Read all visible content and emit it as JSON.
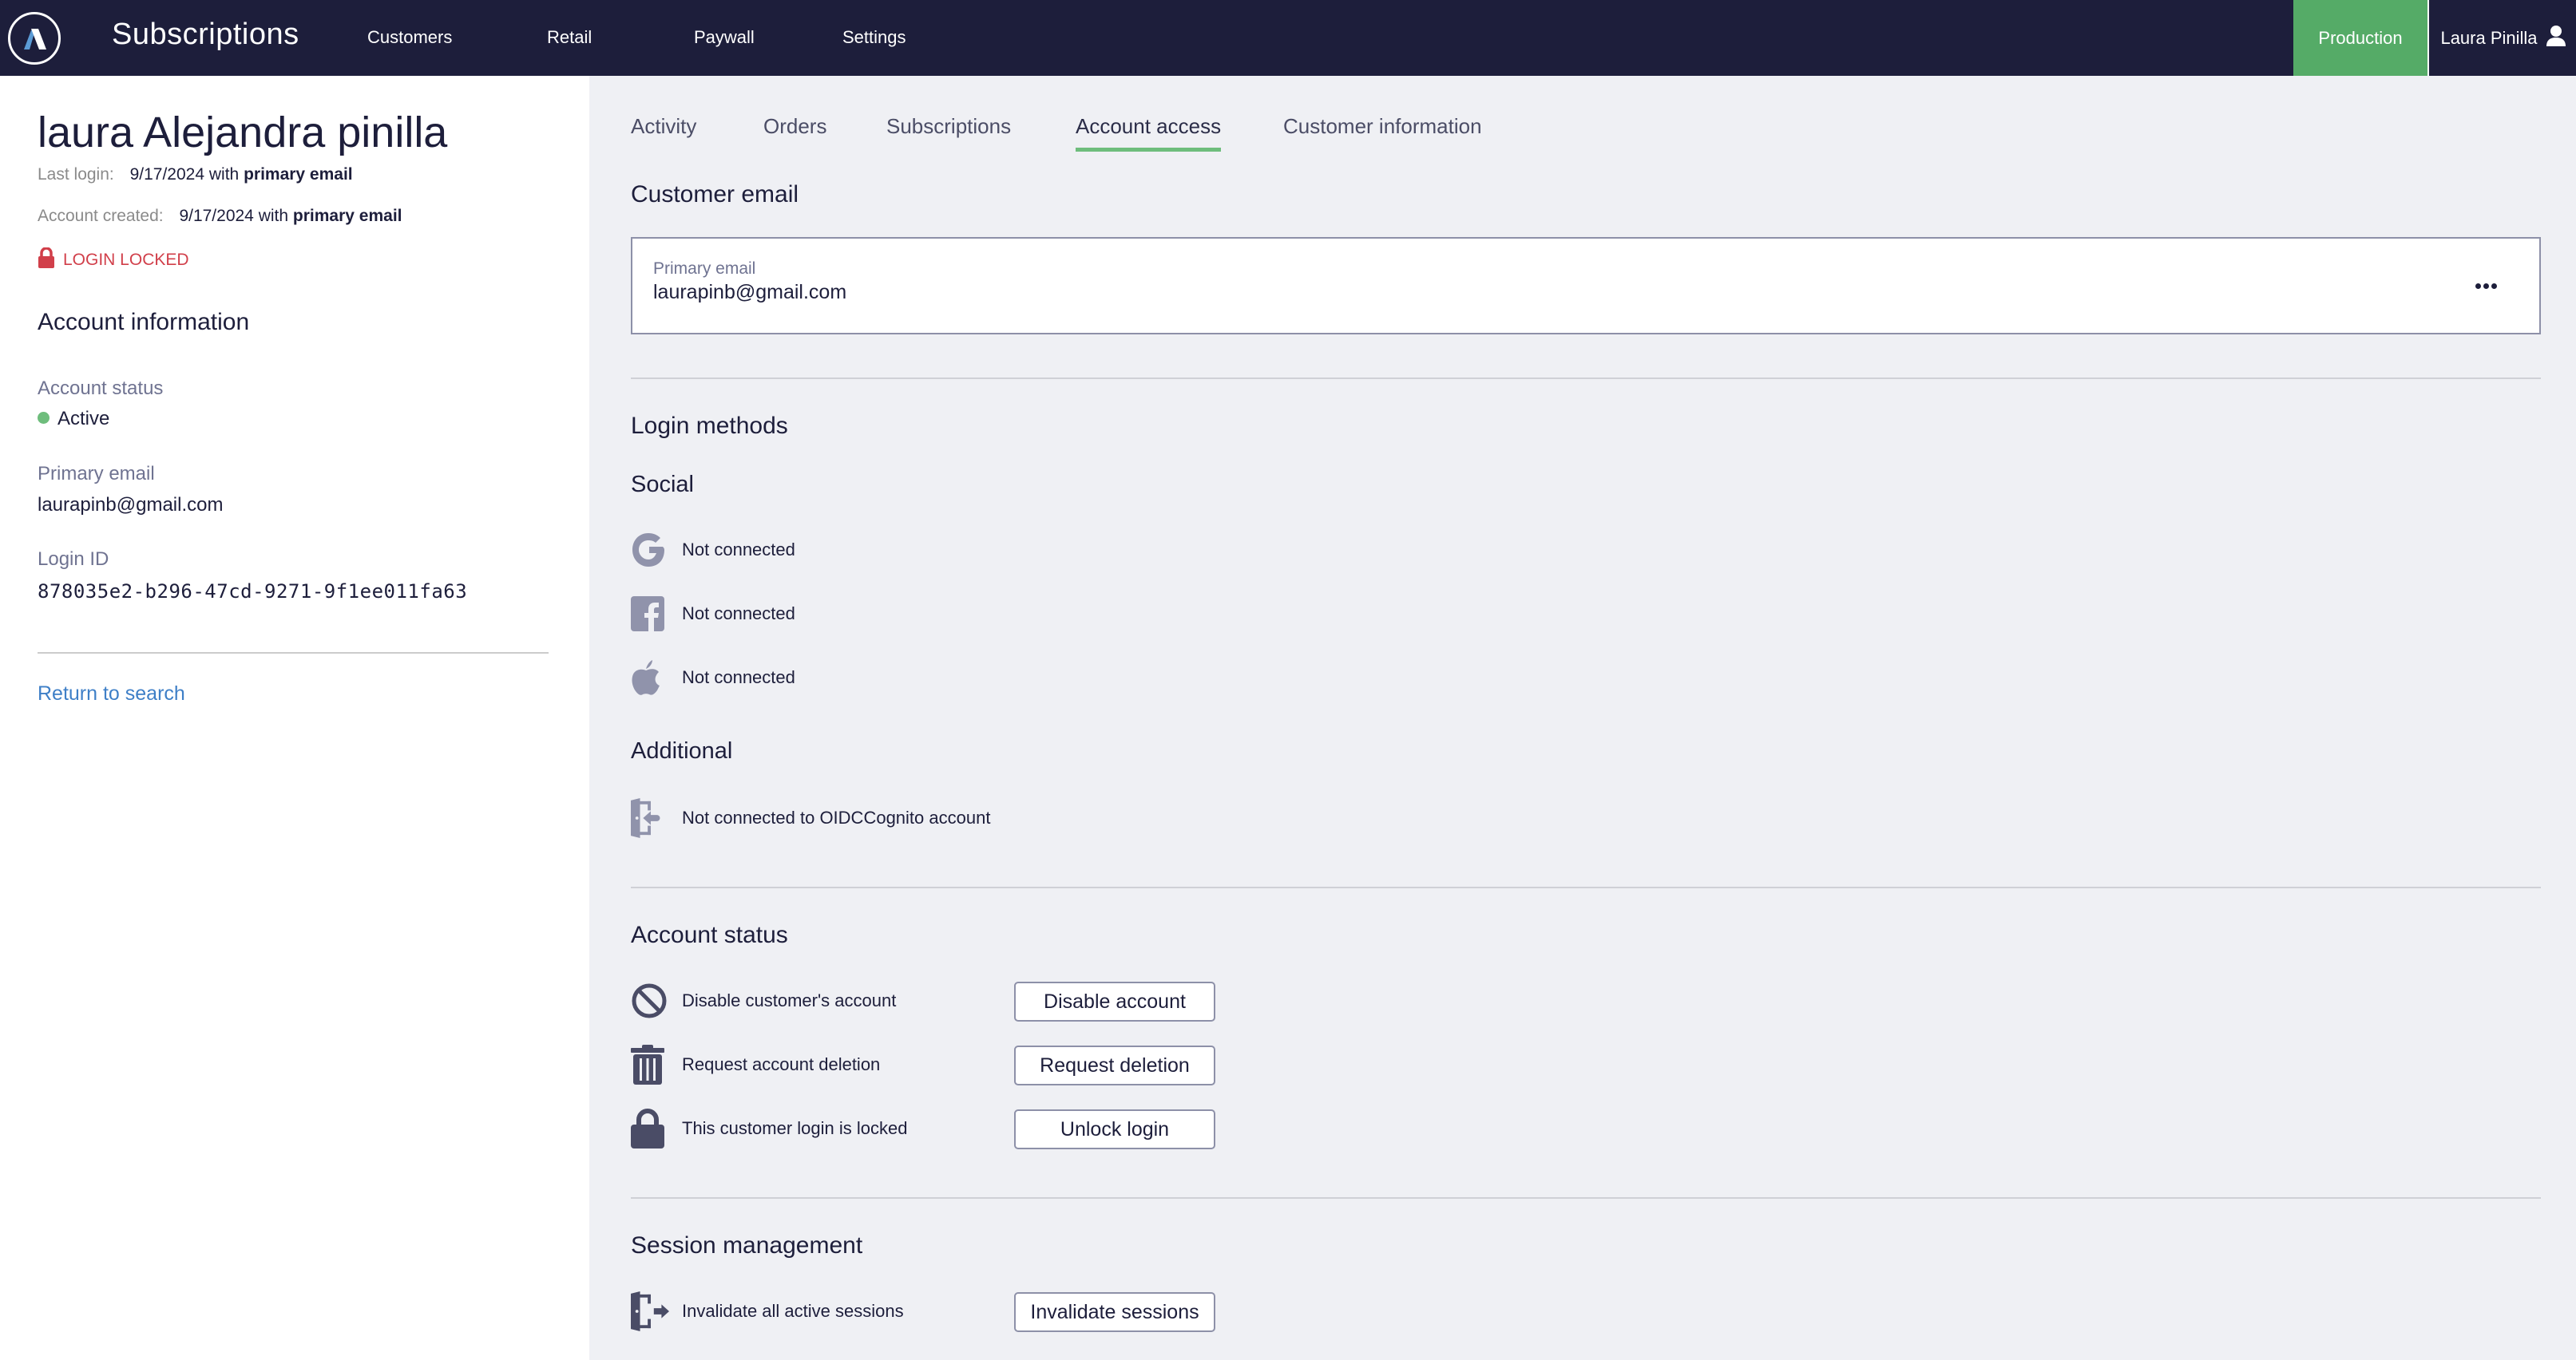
{
  "header": {
    "logo_icon": "brand-logo-icon",
    "app_title": "Subscriptions",
    "nav": [
      {
        "label": "Customers"
      },
      {
        "label": "Retail"
      },
      {
        "label": "Paywall"
      },
      {
        "label": "Settings"
      }
    ],
    "environment": "Production",
    "user_name": "Laura Pinilla",
    "user_icon": "user-icon",
    "colors": {
      "header_bg": "#1d1e3b",
      "environment_bg": "#55ab67"
    }
  },
  "sidebar": {
    "customer_name": "laura Alejandra pinilla",
    "last_login": {
      "label": "Last login:",
      "date": "9/17/2024",
      "with": "with",
      "method": "primary email"
    },
    "account_created": {
      "label": "Account created:",
      "date": "9/17/2024",
      "with": "with",
      "method": "primary email"
    },
    "lock_badge": {
      "icon": "lock-icon",
      "label": "LOGIN LOCKED",
      "color": "#d13f4a"
    },
    "section_title": "Account information",
    "fields": {
      "account_status": {
        "label": "Account status",
        "value": "Active",
        "status_color": "#6ebd7c"
      },
      "primary_email": {
        "label": "Primary email",
        "value": "laurapinb@gmail.com"
      },
      "login_id": {
        "label": "Login ID",
        "value": "878035e2-b296-47cd-9271-9f1ee011fa63"
      }
    },
    "return_link": "Return to search"
  },
  "main": {
    "tabs": [
      {
        "label": "Activity",
        "active": false
      },
      {
        "label": "Orders",
        "active": false
      },
      {
        "label": "Subscriptions",
        "active": false
      },
      {
        "label": "Account access",
        "active": true
      },
      {
        "label": "Customer information",
        "active": false
      }
    ],
    "customer_email": {
      "title": "Customer email",
      "card_label": "Primary email",
      "card_value": "laurapinb@gmail.com",
      "more_icon": "more-horizontal-icon"
    },
    "login_methods": {
      "title": "Login methods",
      "social_title": "Social",
      "social": [
        {
          "provider": "Google",
          "icon": "google-icon",
          "status": "Not connected"
        },
        {
          "provider": "Facebook",
          "icon": "facebook-icon",
          "status": "Not connected"
        },
        {
          "provider": "Apple",
          "icon": "apple-icon",
          "status": "Not connected"
        }
      ],
      "additional_title": "Additional",
      "additional": [
        {
          "icon": "sign-in-icon",
          "status": "Not connected to OIDCCognito account"
        }
      ]
    },
    "account_status": {
      "title": "Account status",
      "actions": [
        {
          "icon": "ban-icon",
          "description": "Disable customer's account",
          "button": "Disable account"
        },
        {
          "icon": "trash-icon",
          "description": "Request account deletion",
          "button": "Request deletion"
        },
        {
          "icon": "lock-icon",
          "description": "This customer login is locked",
          "button": "Unlock login"
        }
      ]
    },
    "session_management": {
      "title": "Session management",
      "actions": [
        {
          "icon": "sign-out-icon",
          "description": "Invalidate all active sessions",
          "button": "Invalidate sessions"
        }
      ]
    },
    "colors": {
      "tab_active_underline": "#6ebd7c",
      "link": "#3e7fc7",
      "icon_gray": "#9093ab",
      "icon_dark": "#4a4c66"
    }
  }
}
